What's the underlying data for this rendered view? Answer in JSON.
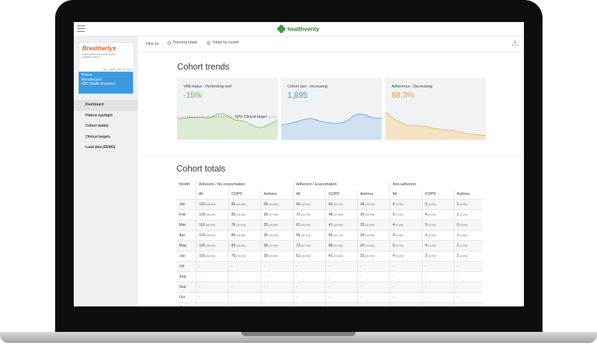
{
  "app": {
    "brand": "healthverity"
  },
  "sidebar": {
    "logo": {
      "name": "Breatherlyx",
      "tagline": "Lorem ipsum dolor amet conse inhalation-based",
      "dates": "Jan 1, 2019 - Dec 31, 2019"
    },
    "parties": {
      "label": "Parties:",
      "lines": [
        "Manufacturer",
        "ABC Health Insurance"
      ]
    },
    "nav": [
      {
        "label": "Dashboard",
        "active": true
      },
      {
        "label": "Patient spotlight",
        "active": false
      },
      {
        "label": "Cohort details",
        "active": false
      },
      {
        "label": "Clinical targets",
        "active": false
      },
      {
        "label": "Load data (DEMO)",
        "active": false
      }
    ]
  },
  "viewbar": {
    "label": "View by:",
    "options": [
      {
        "label": "Running totals",
        "selected": false
      },
      {
        "label": "Totals by month",
        "selected": true
      }
    ],
    "download_icon": "download-icon"
  },
  "trends": {
    "title": "Cohort trends",
    "cards": [
      {
        "label": "VBA status",
        "status": "Performing well",
        "value": "-15%",
        "color": "#6ab04c",
        "target_label": "50% Clinical target"
      },
      {
        "label": "Cohort size",
        "status": "Increasing",
        "value": "1,895",
        "color": "#4a90d9"
      },
      {
        "label": "Adherence",
        "status": "Decreasing",
        "value": "88.3%",
        "color": "#e6a23c"
      }
    ]
  },
  "totals": {
    "title": "Cohort totals",
    "month_header": "Month",
    "groups": [
      "Adherent / No exacerbation",
      "Adherent / Exacerbation",
      "Non-adherent"
    ],
    "sub_headers": [
      "All",
      "COPD",
      "Asthma",
      "All",
      "COPD",
      "Asthma",
      "All",
      "COPD",
      "Asthma"
    ],
    "rows": [
      {
        "month": "Jan",
        "cells": [
          [
            "120",
            "(58.2%)"
          ],
          [
            "85",
            "(34.8%)"
          ],
          [
            "35",
            "(28.0%)"
          ],
          [
            "66",
            "(40.1%)"
          ],
          [
            "42",
            "(24.7%)"
          ],
          [
            "24",
            "(15.2%)"
          ],
          [
            "4",
            "(2.0%)"
          ],
          [
            "3",
            "(1.5%)"
          ],
          [
            "1",
            "(0.5%)"
          ]
        ]
      },
      {
        "month": "Feb",
        "cells": [
          [
            "126",
            "(56.2%)"
          ],
          [
            "83",
            "(34.4%)"
          ],
          [
            "39",
            "(27.3%)"
          ],
          [
            "72",
            "(42.7%)"
          ],
          [
            "48",
            "(27.6%)"
          ],
          [
            "20",
            "(15.9%)"
          ],
          [
            "5",
            "(2.0%)"
          ],
          [
            "4",
            "(2.0%)"
          ],
          [
            "2",
            "(1.2%)"
          ]
        ]
      },
      {
        "month": "Mar",
        "cells": [
          [
            "116",
            "(50.9%)"
          ],
          [
            "76",
            "(30.1%)"
          ],
          [
            "33",
            "(25.6%)"
          ],
          [
            "61",
            "(45.0%)"
          ],
          [
            "41",
            "(25.6%)"
          ],
          [
            "22",
            "(20.0%)"
          ],
          [
            "4",
            "(5.4%)"
          ],
          [
            "3",
            "(2.0%)"
          ],
          [
            "2",
            "(0.5%)"
          ]
        ]
      },
      {
        "month": "Apr",
        "cells": [
          [
            "120",
            "(58.2%)"
          ],
          [
            "85",
            "(34.8%)"
          ],
          [
            "35",
            "(28.0%)"
          ],
          [
            "66",
            "(40.1%)"
          ],
          [
            "42",
            "(24.7%)"
          ],
          [
            "24",
            "(15.2%)"
          ],
          [
            "4",
            "(2.0%)"
          ],
          [
            "3",
            "(1.5%)"
          ],
          [
            "1",
            "(0.5%)"
          ]
        ]
      },
      {
        "month": "May",
        "cells": [
          [
            "126",
            "(56.2%)"
          ],
          [
            "83",
            "(34.4%)"
          ],
          [
            "39",
            "(27.3%)"
          ],
          [
            "72",
            "(42.7%)"
          ],
          [
            "48",
            "(27.6%)"
          ],
          [
            "20",
            "(15.9%)"
          ],
          [
            "5",
            "(2.0%)"
          ],
          [
            "4",
            "(2.0%)"
          ],
          [
            "2",
            "(1.2%)"
          ]
        ]
      },
      {
        "month": "Jun",
        "cells": [
          [
            "116",
            "(50.9%)"
          ],
          [
            "76",
            "(30.1%)"
          ],
          [
            "33",
            "(25.6%)"
          ],
          [
            "61",
            "(45.0%)"
          ],
          [
            "41",
            "(25.6%)"
          ],
          [
            "22",
            "(20.0%)"
          ],
          [
            "4",
            "(5.4%)"
          ],
          [
            "3",
            "(2.0%)"
          ],
          [
            "2",
            "(0.5%)"
          ]
        ]
      },
      {
        "month": "Jul",
        "cells": [
          [
            "-",
            ""
          ],
          [
            "-",
            ""
          ],
          [
            "-",
            ""
          ],
          [
            "-",
            ""
          ],
          [
            "-",
            ""
          ],
          [
            "-",
            ""
          ],
          [
            "-",
            ""
          ],
          [
            "-",
            ""
          ],
          [
            "-",
            ""
          ]
        ]
      },
      {
        "month": "Aug",
        "cells": [
          [
            "-",
            ""
          ],
          [
            "-",
            ""
          ],
          [
            "-",
            ""
          ],
          [
            "-",
            ""
          ],
          [
            "-",
            ""
          ],
          [
            "-",
            ""
          ],
          [
            "-",
            ""
          ],
          [
            "-",
            ""
          ],
          [
            "-",
            ""
          ]
        ]
      },
      {
        "month": "Sep",
        "cells": [
          [
            "-",
            ""
          ],
          [
            "-",
            ""
          ],
          [
            "-",
            ""
          ],
          [
            "-",
            ""
          ],
          [
            "-",
            ""
          ],
          [
            "-",
            ""
          ],
          [
            "-",
            ""
          ],
          [
            "-",
            ""
          ],
          [
            "-",
            ""
          ]
        ]
      },
      {
        "month": "Oct",
        "cells": [
          [
            "-",
            ""
          ],
          [
            "-",
            ""
          ],
          [
            "-",
            ""
          ],
          [
            "-",
            ""
          ],
          [
            "-",
            ""
          ],
          [
            "-",
            ""
          ],
          [
            "-",
            ""
          ],
          [
            "-",
            ""
          ],
          [
            "-",
            ""
          ]
        ]
      },
      {
        "month": "Nov",
        "cells": [
          [
            "-",
            ""
          ],
          [
            "-",
            ""
          ],
          [
            "-",
            ""
          ],
          [
            "-",
            ""
          ],
          [
            "-",
            ""
          ],
          [
            "-",
            ""
          ],
          [
            "-",
            ""
          ],
          [
            "-",
            ""
          ],
          [
            "-",
            ""
          ]
        ]
      }
    ]
  }
}
